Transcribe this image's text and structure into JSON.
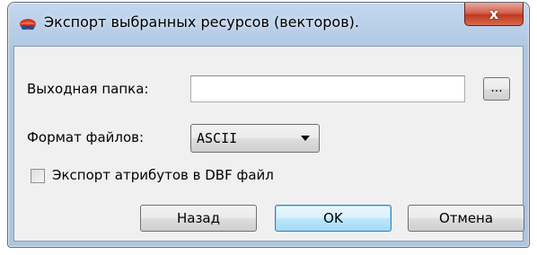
{
  "window": {
    "title": "Экспорт выбранных ресурсов (векторов).",
    "close_label": "x",
    "app_icon": "red-blue-glasses-icon"
  },
  "form": {
    "output_folder_label": "Выходная папка:",
    "output_folder_value": "",
    "browse_label": "...",
    "file_format_label": "Формат файлов:",
    "file_format_value": "ASCII",
    "export_attributes_label": "Экспорт атрибутов в DBF файл",
    "export_attributes_checked": false
  },
  "buttons": {
    "back": "Назад",
    "ok": "OK",
    "cancel": "Отмена"
  },
  "colors": {
    "titlebar": "#b4cbe6",
    "close_button": "#c0391f",
    "client_background": "#f0f0f0",
    "default_button_border": "#3c7fb1"
  }
}
